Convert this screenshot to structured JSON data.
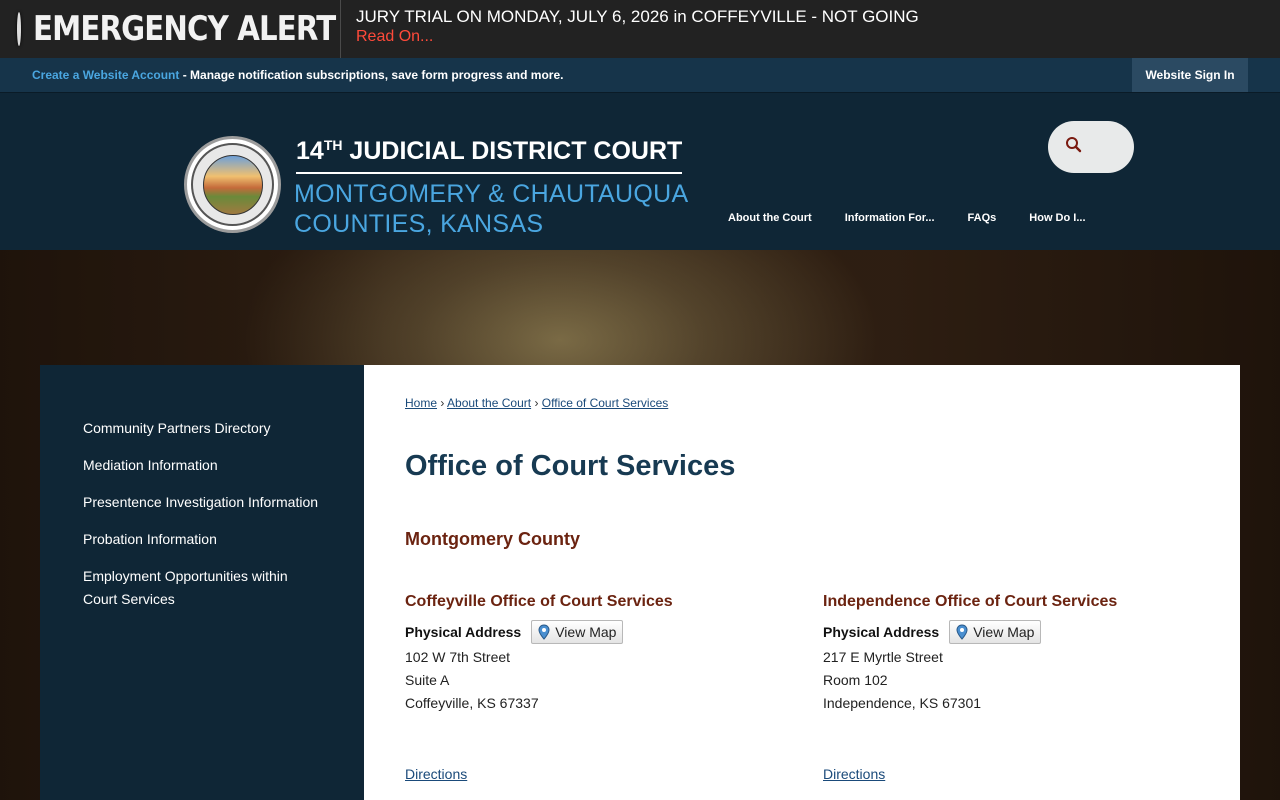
{
  "alert": {
    "label": "EMERGENCY ALERT",
    "title": "JURY TRIAL ON MONDAY, JULY 6, 2026 in COFFEYVILLE - NOT GOING",
    "link": "Read On..."
  },
  "account": {
    "create_link": "Create a Website Account",
    "description": " - Manage notification subscriptions, save form progress and more.",
    "sign_in": "Website Sign In"
  },
  "header": {
    "title_number": "14",
    "title_suffix": "TH",
    "title_rest": " JUDICIAL DISTRICT COURT",
    "subtitle_line1": "MONTGOMERY & CHAUTAUQUA",
    "subtitle_line2": "COUNTIES, KANSAS",
    "nav": [
      "About the Court",
      "Information For...",
      "FAQs",
      "How Do I..."
    ]
  },
  "sidebar": {
    "items": [
      "Community Partners Directory",
      "Mediation Information",
      "Presentence Investigation Information",
      "Probation Information",
      "Employment Opportunities within Court Services"
    ]
  },
  "main": {
    "breadcrumb": [
      "Home",
      "About the Court",
      "Office of Court Services"
    ],
    "breadcrumb_sep": "›",
    "title": "Office of Court Services",
    "county": "Montgomery County",
    "offices": [
      {
        "name": "Coffeyville Office of Court Services",
        "address_label": "Physical Address",
        "map_label": "View Map",
        "lines": [
          "102 W 7th Street",
          "Suite A",
          "Coffeyville, KS 67337"
        ],
        "directions": "Directions"
      },
      {
        "name": "Independence Office of Court Services",
        "address_label": "Physical Address",
        "map_label": "View Map",
        "lines": [
          "217 E Myrtle Street",
          "Room 102",
          "Independence, KS 67301"
        ],
        "directions": "Directions"
      }
    ]
  },
  "colors": {
    "navy": "#0f2636",
    "accent_blue": "#4aa6e0",
    "heading_brown": "#6b2310",
    "alert_red": "#ff4a3a"
  }
}
